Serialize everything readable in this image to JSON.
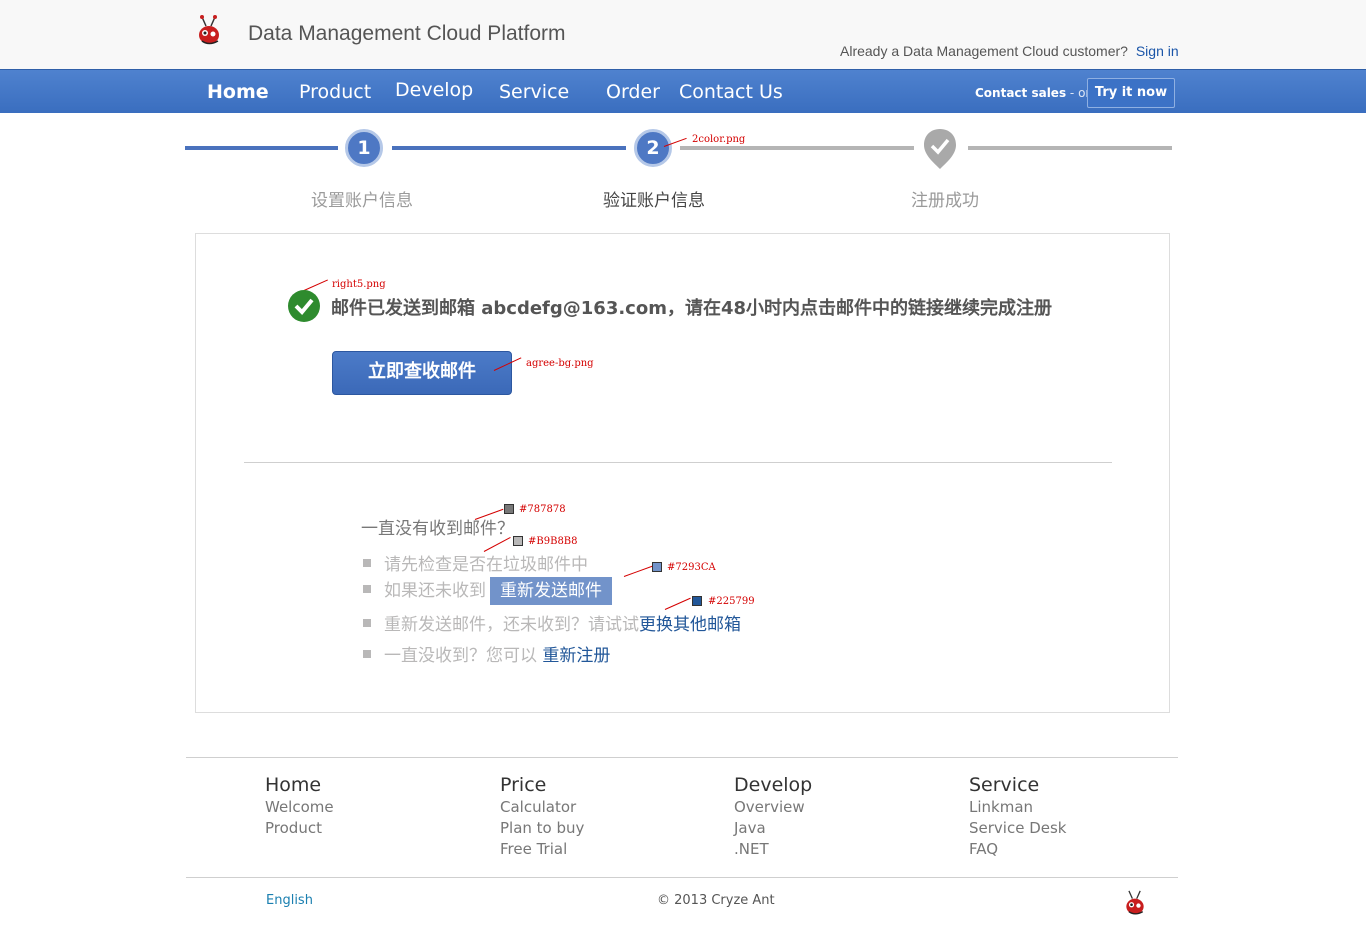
{
  "header": {
    "site_title": "Data Management Cloud Platform",
    "customer_prompt": "Already a Data Management Cloud customer?",
    "sign_in": "Sign in"
  },
  "nav": {
    "items": [
      "Home",
      "Product",
      "Develop",
      "Service",
      "Order",
      "Contact Us"
    ],
    "contact_sales": "Contact sales",
    "or": "- or -",
    "try_it_now": "Try it now"
  },
  "steps": {
    "items": [
      {
        "number": "1",
        "label": "设置账户信息"
      },
      {
        "number": "2",
        "label": "验证账户信息"
      },
      {
        "number": "",
        "label": "注册成功"
      }
    ],
    "current": 2
  },
  "annotations": {
    "color_png": "2color.png",
    "right_png": "right5.png",
    "agree_png": "agree-bg.png",
    "c1": "#787878",
    "c2": "#B9B8B8",
    "c3": "#7293CA",
    "c4": "#225799"
  },
  "main": {
    "sent_message": "邮件已发送到邮箱 abcdefg@163.com，请在48小时内点击邮件中的链接继续完成注册",
    "check_mail_button": "立即查收邮件",
    "help_title": "一直没有收到邮件？",
    "tips": [
      {
        "text": "请先检查是否在垃圾邮件中"
      },
      {
        "text": "如果还未收到",
        "action": "重新发送邮件"
      },
      {
        "text": "重新发送邮件，还未收到？请试试",
        "action": "更换其他邮箱"
      },
      {
        "text": "一直没收到？您可以",
        "action": "重新注册"
      }
    ]
  },
  "footer": {
    "columns": [
      {
        "title": "Home",
        "links": [
          "Welcome",
          "Product"
        ]
      },
      {
        "title": "Price",
        "links": [
          "Calculator",
          "Plan to buy",
          "Free Trial"
        ]
      },
      {
        "title": "Develop",
        "links": [
          "Overview",
          "Java",
          ".NET"
        ]
      },
      {
        "title": "Service",
        "links": [
          "Linkman",
          "Service Desk",
          "FAQ"
        ]
      }
    ],
    "language": "English",
    "copyright": "© 2013 Cryze Ant"
  },
  "colors": {
    "nav_blue": "#3a6ebf",
    "step_blue": "#4e78c4",
    "success_green": "#2e8b2e",
    "title_gray": "#787878",
    "tip_gray": "#b9b8b8",
    "resend_bg": "#7293ca",
    "link_dark": "#225799"
  }
}
